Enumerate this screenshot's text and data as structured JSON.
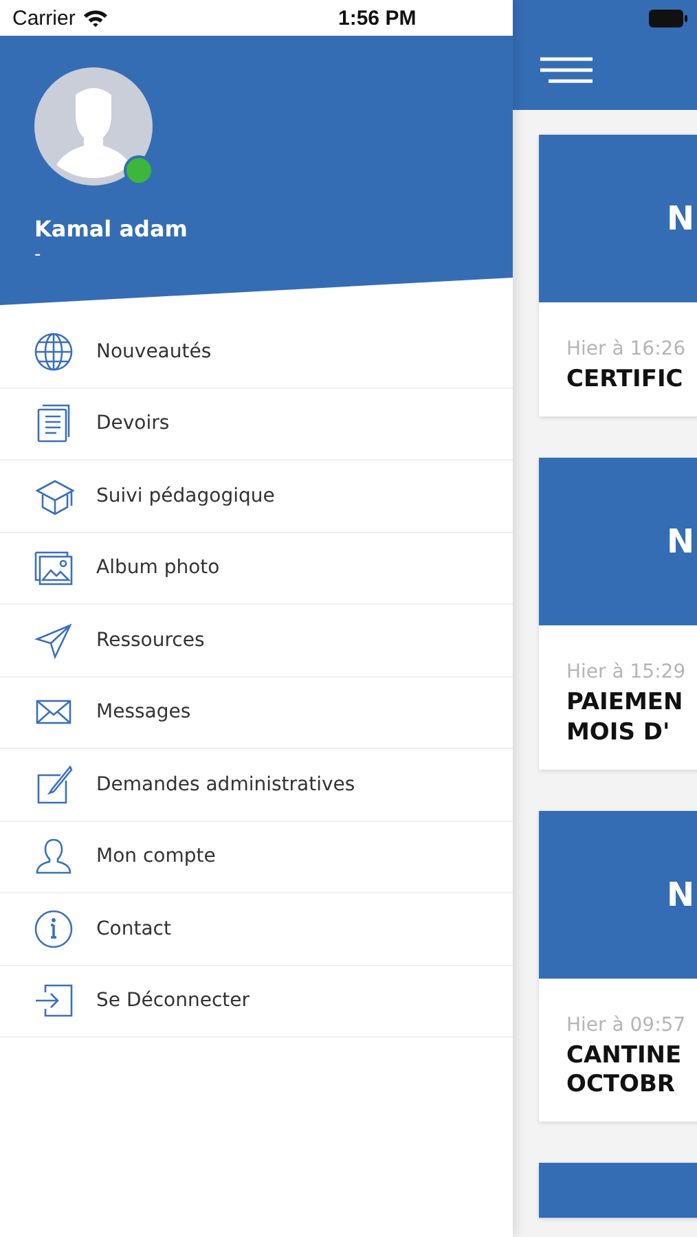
{
  "status_bar": {
    "carrier": "Carrier",
    "time": "1:56 PM"
  },
  "profile": {
    "name": "Kamal adam",
    "subtitle": "-",
    "online": true
  },
  "menu": [
    {
      "label": "Nouveautés",
      "kind": "globe"
    },
    {
      "label": "Devoirs",
      "kind": "document"
    },
    {
      "label": "Suivi pédagogique",
      "kind": "cap"
    },
    {
      "label": "Album photo",
      "kind": "photos"
    },
    {
      "label": "Ressources",
      "kind": "send"
    },
    {
      "label": "Messages",
      "kind": "mail"
    },
    {
      "label": "Demandes administratives",
      "kind": "edit"
    },
    {
      "label": "Mon compte",
      "kind": "user"
    },
    {
      "label": "Contact",
      "kind": "info"
    },
    {
      "label": "Se Déconnecter",
      "kind": "logout"
    }
  ],
  "cards": [
    {
      "banner": "N",
      "date": "Hier à 16:26",
      "title_lines": [
        "CERTIFIC"
      ]
    },
    {
      "banner": "N",
      "date": "Hier à 15:29",
      "title_lines": [
        "PAIEMEN",
        "MOIS D'"
      ]
    },
    {
      "banner": "N",
      "date": "Hier à 09:57",
      "title_lines": [
        "CANTINE",
        "OCTOBR"
      ]
    }
  ]
}
